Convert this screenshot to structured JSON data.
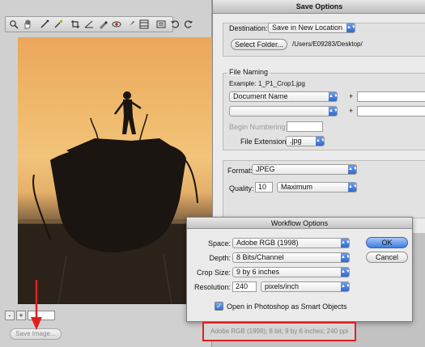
{
  "save_options": {
    "title": "Save Options",
    "destination_label": "Destination:",
    "destination_value": "Save in New Location",
    "select_folder_label": "Select Folder...",
    "folder_path": "/Users/E09283/Desktop/",
    "file_naming_label": "File Naming",
    "example_label": "Example:",
    "example_value": "1_P1_Crop1.jpg",
    "naming_1": "Document Name",
    "naming_2": "",
    "plus": "+",
    "begin_numbering_label": "Begin Numbering:",
    "file_extension_label": "File Extension:",
    "file_extension_value": ".jpg",
    "format_label": "Format:",
    "format_value": "JPEG",
    "quality_label": "Quality:",
    "quality_value": "10",
    "quality_preset": "Maximum"
  },
  "workflow": {
    "title": "Workflow Options",
    "space_label": "Space:",
    "space_value": "Adobe RGB (1998)",
    "depth_label": "Depth:",
    "depth_value": "8 Bits/Channel",
    "crop_label": "Crop Size:",
    "crop_value": "9 by 6 inches",
    "resolution_label": "Resolution:",
    "resolution_value": "240",
    "resolution_unit": "pixels/inch",
    "smart_objects_label": "Open in Photoshop as Smart Objects",
    "ok_label": "OK",
    "cancel_label": "Cancel"
  },
  "left_pane": {
    "save_image_label": "Save Image...",
    "zoom_minus": "-",
    "zoom_plus": "+",
    "zoom_value": ""
  },
  "status_text": "Adobe RGB (1998); 8 bit; 9 by 6 inches; 240 ppi",
  "colors": {
    "accent_blue": "#3d7fe0",
    "highlight_red": "#e02020"
  },
  "icons": [
    "zoom-tool-icon",
    "hand-tool-icon",
    "white-balance-icon",
    "color-sampler-icon",
    "crop-tool-icon",
    "straighten-icon",
    "spot-removal-icon",
    "red-eye-icon",
    "adjustment-brush-icon",
    "graduated-filter-icon",
    "preferences-icon",
    "rotate-left-icon",
    "rotate-right-icon"
  ]
}
